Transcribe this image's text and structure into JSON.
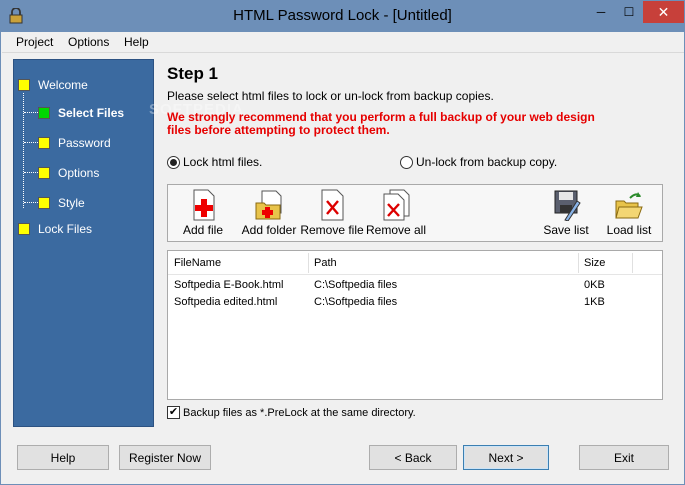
{
  "window": {
    "title": "HTML Password Lock  -  [Untitled]",
    "min_glyph": "─",
    "max_glyph": "☐",
    "close_glyph": "✕"
  },
  "menu": [
    "Project",
    "Options",
    "Help"
  ],
  "sidebar": {
    "items": [
      {
        "label": "Welcome",
        "active": false
      },
      {
        "label": "Select Files",
        "active": true
      },
      {
        "label": "Password",
        "active": false
      },
      {
        "label": "Options",
        "active": false
      },
      {
        "label": "Style",
        "active": false
      },
      {
        "label": "Lock Files",
        "active": false
      }
    ]
  },
  "watermark": "SOFTPEDIA",
  "step": {
    "title": "Step 1",
    "description": "Please select html files to lock or un-lock from backup copies.",
    "warning_line1": "We strongly recommend that you perform a full backup of your web design",
    "warning_line2": "files before attempting to protect them."
  },
  "mode": {
    "lock_label": "Lock html files.",
    "lock_selected": true,
    "unlock_label": "Un-lock from backup copy.",
    "unlock_selected": false
  },
  "toolbar": {
    "add_file": "Add file",
    "add_folder": "Add folder",
    "remove_file": "Remove file",
    "remove_all": "Remove all",
    "save_list": "Save list",
    "load_list": "Load list"
  },
  "filelist": {
    "columns": [
      "FileName",
      "Path",
      "Size"
    ],
    "rows": [
      [
        "Softpedia E-Book.html",
        "C:\\Softpedia files",
        "0KB"
      ],
      [
        "Softpedia edited.html",
        "C:\\Softpedia files",
        "1KB"
      ]
    ]
  },
  "backup": {
    "checked": true,
    "check_glyph": "✔",
    "label": "Backup files as *.PreLock at the same directory."
  },
  "buttons": {
    "help": "Help",
    "register": "Register Now",
    "back": "< Back",
    "next": "Next >",
    "exit": "Exit"
  },
  "colors": {
    "sidebar_bg": "#3b6aa0",
    "titlebar_bg": "#6d8fb8",
    "warning": "#e60000",
    "nav_box": "#ffff00",
    "nav_box_active": "#00d800",
    "close_button": "#c7403a"
  }
}
